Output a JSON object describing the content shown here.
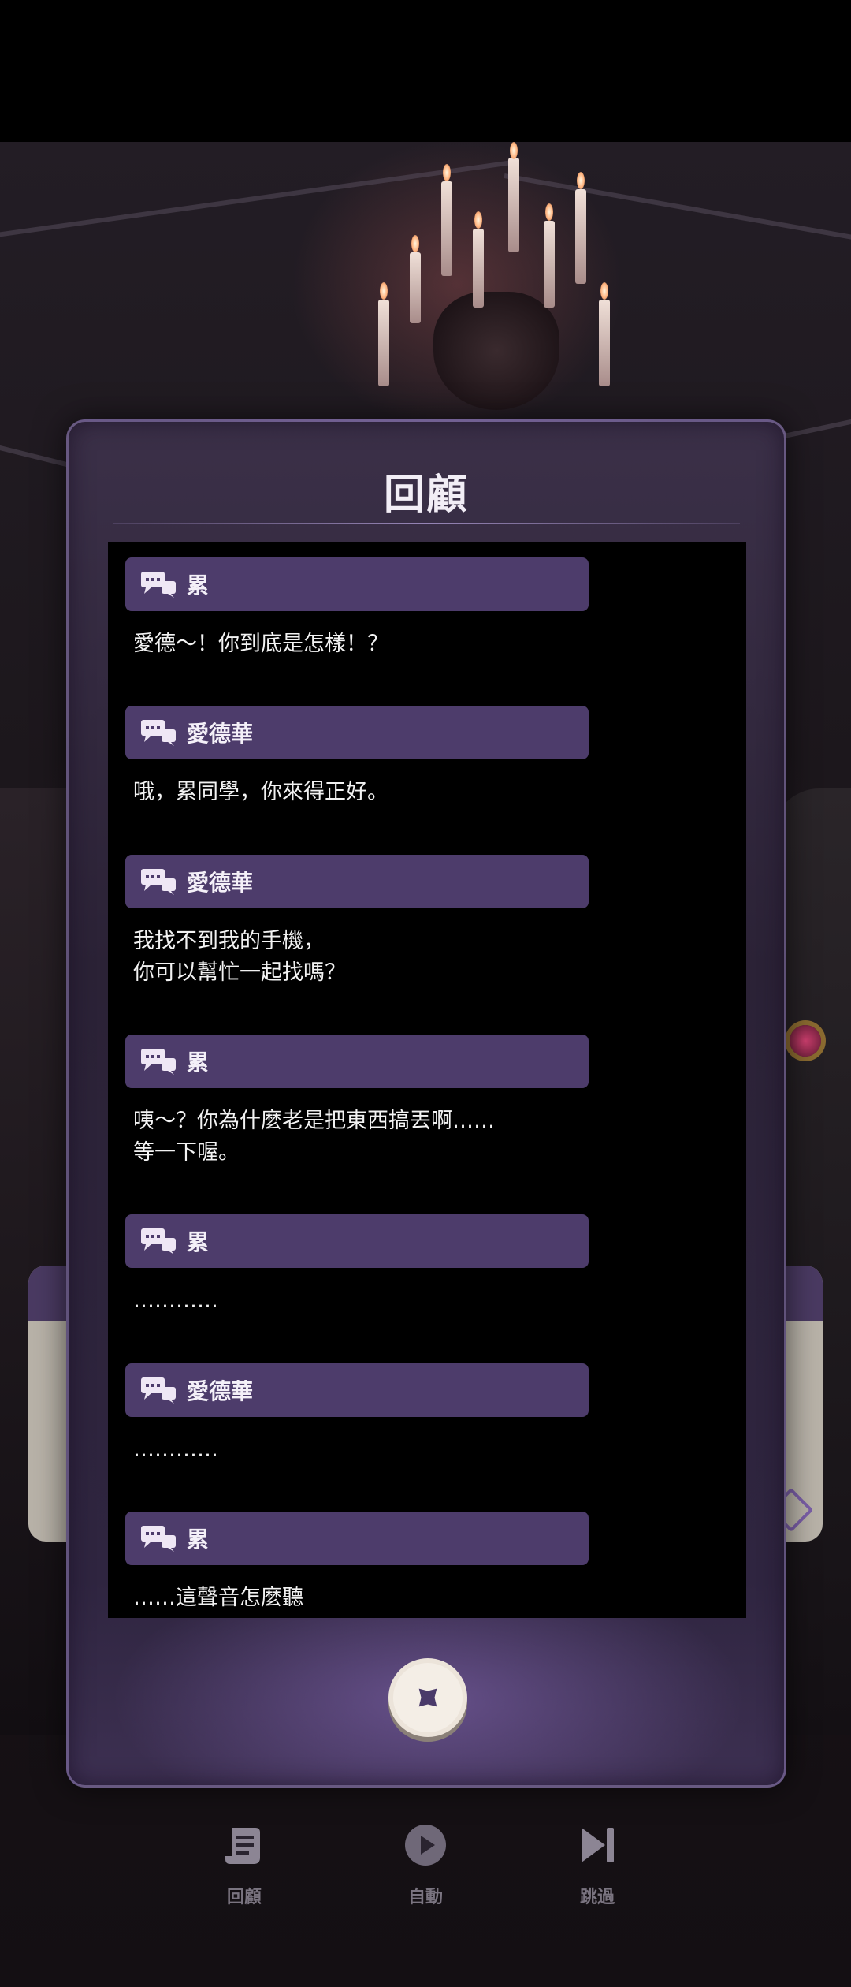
{
  "modal": {
    "title": "回顧",
    "close_icon": "close-x-icon"
  },
  "log": [
    {
      "speaker": "累",
      "text": "愛德～！你到底是怎樣！？"
    },
    {
      "speaker": "愛德華",
      "text": "哦，累同學，你來得正好。"
    },
    {
      "speaker": "愛德華",
      "text": "我找不到我的手機，\n你可以幫忙一起找嗎？"
    },
    {
      "speaker": "累",
      "text": "咦～？你為什麼老是把東西搞丟啊……\n等一下喔。"
    },
    {
      "speaker": "累",
      "text": "…………"
    },
    {
      "speaker": "愛德華",
      "text": "…………"
    },
    {
      "speaker": "累",
      "text": "……這聲音怎麼聽"
    }
  ],
  "bottom_menu": {
    "review": {
      "label": "回顧",
      "icon": "scroll-icon"
    },
    "auto": {
      "label": "自動",
      "icon": "play-icon"
    },
    "skip": {
      "label": "跳過",
      "icon": "skip-forward-icon"
    }
  },
  "colors": {
    "speaker_bar": "#4d3c6b",
    "modal_bg": "#2b2236",
    "log_bg": "#000000",
    "menu_label": "#7a7480",
    "close_button_face": "#ece4da",
    "close_x": "#4a3a6a"
  }
}
